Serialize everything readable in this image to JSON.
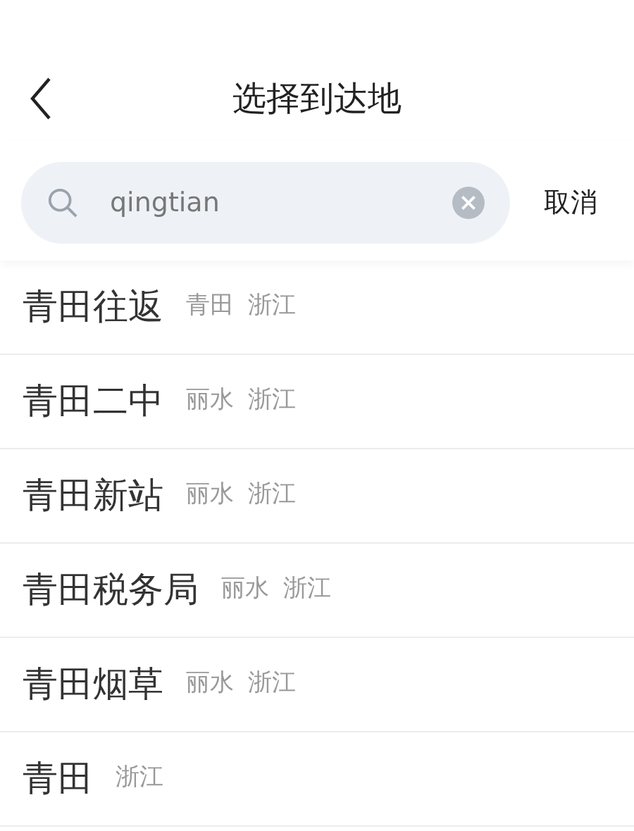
{
  "header": {
    "title": "选择到达地"
  },
  "search": {
    "value": "qingtian",
    "cancel": "取消"
  },
  "results": [
    {
      "name": "青田往返",
      "tags": [
        "青田",
        "浙江"
      ]
    },
    {
      "name": "青田二中",
      "tags": [
        "丽水",
        "浙江"
      ]
    },
    {
      "name": "青田新站",
      "tags": [
        "丽水",
        "浙江"
      ]
    },
    {
      "name": "青田税务局",
      "tags": [
        "丽水",
        "浙江"
      ]
    },
    {
      "name": "青田烟草",
      "tags": [
        "丽水",
        "浙江"
      ]
    },
    {
      "name": "青田",
      "tags": [
        "浙江"
      ]
    }
  ]
}
